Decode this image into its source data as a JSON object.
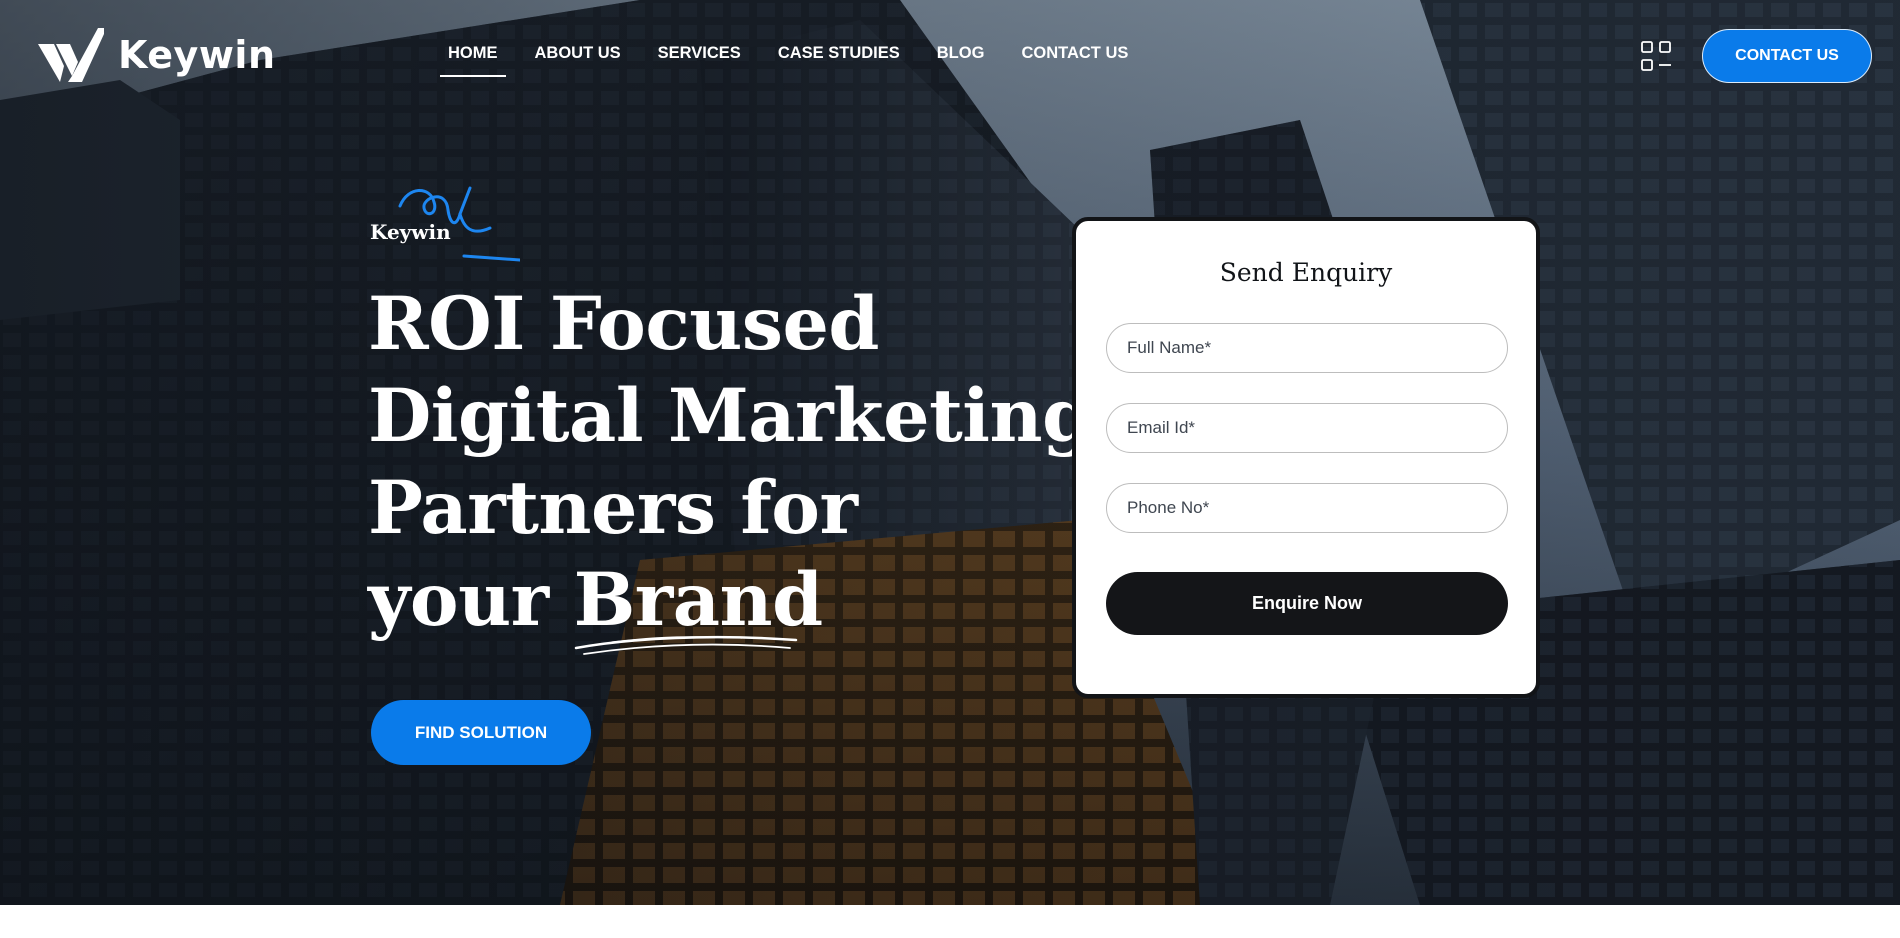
{
  "brand": {
    "name": "Keywin"
  },
  "nav": {
    "items": [
      {
        "label": "HOME",
        "active": true
      },
      {
        "label": "ABOUT US",
        "active": false
      },
      {
        "label": "SERVICES",
        "active": false
      },
      {
        "label": "CASE STUDIES",
        "active": false
      },
      {
        "label": "BLOG",
        "active": false
      },
      {
        "label": "CONTACT US",
        "active": false
      }
    ],
    "menu_icon": "grid-menu-icon",
    "cta_label": "CONTACT US"
  },
  "hero": {
    "tagline": "Keywin",
    "headline_lines": [
      "ROI Focused",
      "Digital Marketing",
      "Partners for"
    ],
    "headline_last_prefix": "your ",
    "headline_highlight": "Brand",
    "cta_label": "FIND SOLUTION"
  },
  "enquiry": {
    "title": "Send Enquiry",
    "fields": {
      "name_placeholder": "Full Name*",
      "email_placeholder": "Email Id*",
      "phone_placeholder": "Phone No*"
    },
    "submit_label": "Enquire Now"
  },
  "colors": {
    "accent": "#0a7bea",
    "dark": "#141518",
    "text_light": "#ffffff"
  }
}
